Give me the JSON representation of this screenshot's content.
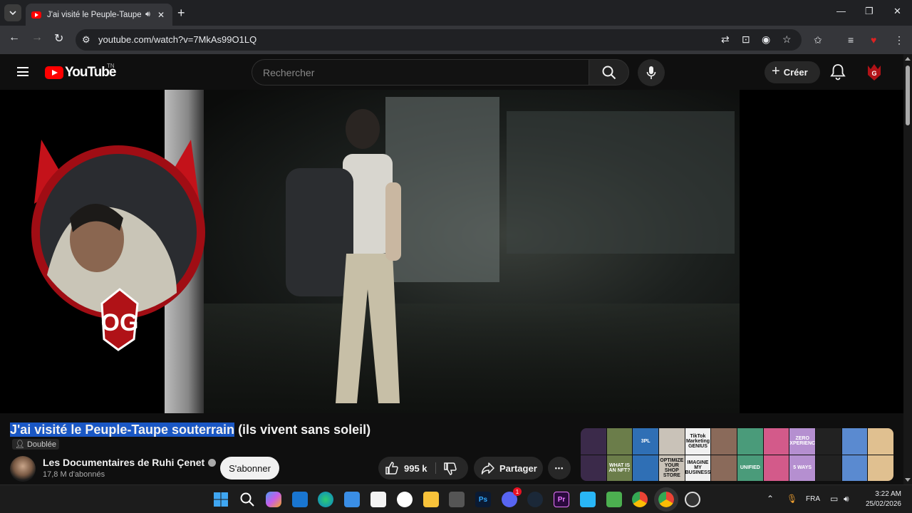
{
  "browser": {
    "tab_title": "J'ai visité le Peuple-Taupe souterrain",
    "url": "youtube.com/watch?v=7MkAs99O1LQ"
  },
  "youtube": {
    "logo_text": "YouTube",
    "logo_superscript": "TN",
    "search_placeholder": "Rechercher",
    "create_label": "Créer"
  },
  "video": {
    "title_selected": "J'ai visité le Peuple-Taupe souterrain",
    "title_rest": " (ils vivent sans soleil)",
    "badge": "Doublée",
    "channel_name": "Les Documentaires de Ruhi Çenet",
    "subscribers": "17,8 M d'abonnés",
    "subscribe_label": "S'abonner",
    "like_count": "995 k",
    "share_label": "Partager",
    "more_label": "•••"
  },
  "ad_tiles": [
    "",
    "",
    "3PL",
    "",
    "TikTok Marketing GENIUS",
    "",
    "",
    "",
    "ZERO EXPERIENCE",
    "",
    "",
    "",
    "",
    "WHAT IS AN NFT?",
    "",
    "OPTIMIZE YOUR SHOP STORE",
    "IMAGINE MY BUSINESS",
    "",
    "UNIFIED",
    "",
    "5 WAYS",
    "",
    "",
    ""
  ],
  "taskbar": {
    "language": "FRA",
    "time": "3:22 AM",
    "date": "25/02/2026",
    "discord_badge": "1"
  },
  "colors": {
    "yt_red": "#ff0000",
    "selection": "#1a57c4",
    "background": "#0f0f0f"
  }
}
